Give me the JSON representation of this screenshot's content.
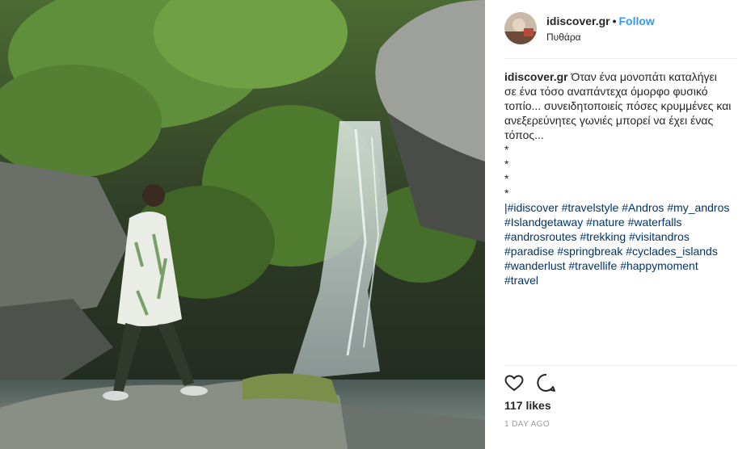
{
  "post": {
    "photo_icon": "waterfall-photo",
    "username": "idiscover.gr",
    "separator": "•",
    "follow_label": "Follow",
    "location": "Πυθάρα",
    "caption_user": "idiscover.gr",
    "caption_lines": [
      "Όταν ένα μονοπάτι καταλήγει",
      "σε ένα τόσο αναπάντεχα όμορφο φυσικό",
      "τοπίο... συνειδητοποιείς πόσες κρυμμένες και",
      "ανεξερεύνητες γωνιές μπορεί να έχει ένας",
      "τόπος...",
      "*",
      "*",
      "*",
      "*"
    ],
    "hashtag_prefix": "|",
    "hashtags": [
      "#idiscover",
      "#travelstyle",
      "#Andros",
      "#my_andros",
      "#Islandgetaway",
      "#nature",
      "#waterfalls",
      "#androsroutes",
      "#trekking",
      "#visitandros",
      "#paradise",
      "#springbreak",
      "#cyclades_islands",
      "#wanderlust",
      "#travellife",
      "#happymoment",
      "#travel"
    ],
    "like_icon": "heart-icon",
    "comment_icon": "comment-icon",
    "likes": "117 likes",
    "time_ago": "1 DAY AGO"
  },
  "colors": {
    "follow": "#3897f0",
    "hashtag": "#003569",
    "muted": "#999999"
  }
}
